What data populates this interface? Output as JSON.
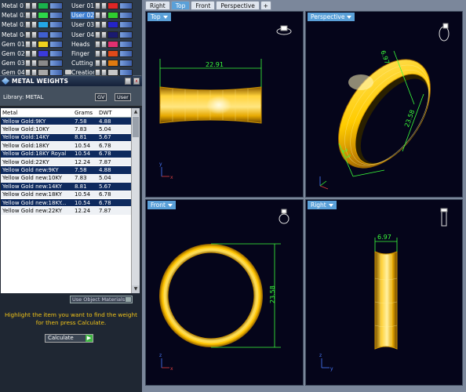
{
  "layers": {
    "left_col": [
      {
        "name": "Metal 01",
        "color": "#19b24c",
        "selected": false
      },
      {
        "name": "Metal 02",
        "color": "#2dd84a",
        "selected": false
      },
      {
        "name": "Metal 03",
        "color": "#23a6e8",
        "selected": false
      },
      {
        "name": "Metal 04",
        "color": "#3f5fd0",
        "selected": false
      },
      {
        "name": "Gem 01",
        "color": "#f0d21e",
        "selected": false
      },
      {
        "name": "Gem 02",
        "color": "#3a3adb",
        "selected": false
      },
      {
        "name": "Gem 03",
        "color": "#8a8a8a",
        "selected": false
      },
      {
        "name": "Gem 04",
        "color": "#a8a8a8",
        "selected": false
      }
    ],
    "right_col": [
      {
        "name": "User 01",
        "color": "#e02626",
        "selected": false
      },
      {
        "name": "User 02",
        "color": "#2fcf2f",
        "selected": true
      },
      {
        "name": "User 03",
        "color": "#2424c8",
        "selected": false
      },
      {
        "name": "User 04",
        "color": "#1a1a70",
        "selected": false
      },
      {
        "name": "Heads",
        "color": "#e03070",
        "selected": false
      },
      {
        "name": "Finger",
        "color": "#e04a1a",
        "selected": false
      },
      {
        "name": "Cutting",
        "color": "#e07a10",
        "selected": false
      },
      {
        "name": "Creation",
        "color": "#c8c8c8",
        "selected": false
      }
    ]
  },
  "metal_weights": {
    "title": "METAL WEIGHTS",
    "library_label": "Library: METAL",
    "lib_buttons": [
      "GV",
      "User"
    ],
    "columns": [
      "Metal",
      "Grams",
      "DWT"
    ],
    "rows": [
      [
        "Yellow Gold:9KY",
        "7.58",
        "4.88"
      ],
      [
        "Yellow Gold:10KY",
        "7.83",
        "5.04"
      ],
      [
        "Yellow Gold:14KY",
        "8.81",
        "5.67"
      ],
      [
        "Yellow Gold:18KY",
        "10.54",
        "6.78"
      ],
      [
        "Yellow Gold:18KY Royal",
        "10.54",
        "6.78"
      ],
      [
        "Yellow Gold:22KY",
        "12.24",
        "7.87"
      ],
      [
        "Yellow Gold new:9KY",
        "7.58",
        "4.88"
      ],
      [
        "Yellow Gold new:10KY",
        "7.83",
        "5.04"
      ],
      [
        "Yellow Gold new:14KY",
        "8.81",
        "5.67"
      ],
      [
        "Yellow Gold new:18KY",
        "10.54",
        "6.78"
      ],
      [
        "Yellow Gold new:18KY...",
        "10.54",
        "6.78"
      ],
      [
        "Yellow Gold new:22KY",
        "12.24",
        "7.87"
      ]
    ],
    "use_object_materials": "Use Object Materials",
    "hint": "Highlight the item you want to find the weight for then press Calculate.",
    "calculate_label": "Calculate"
  },
  "view_tabs": [
    "Right",
    "Top",
    "Front",
    "Perspective",
    "+"
  ],
  "viewports": {
    "top": {
      "label": "Top",
      "dimension": "22.91"
    },
    "perspective": {
      "label": "Perspective",
      "dims": [
        "6.97",
        "23.58",
        "2.3"
      ]
    },
    "front": {
      "label": "Front",
      "dimension": "23.58"
    },
    "right": {
      "label": "Right",
      "dimension": "6.97"
    }
  },
  "colors": {
    "accent": "#5aa0d8",
    "gold": "#f2c000",
    "dimension": "#3bff3b",
    "viewport_bg": "#05051a"
  }
}
